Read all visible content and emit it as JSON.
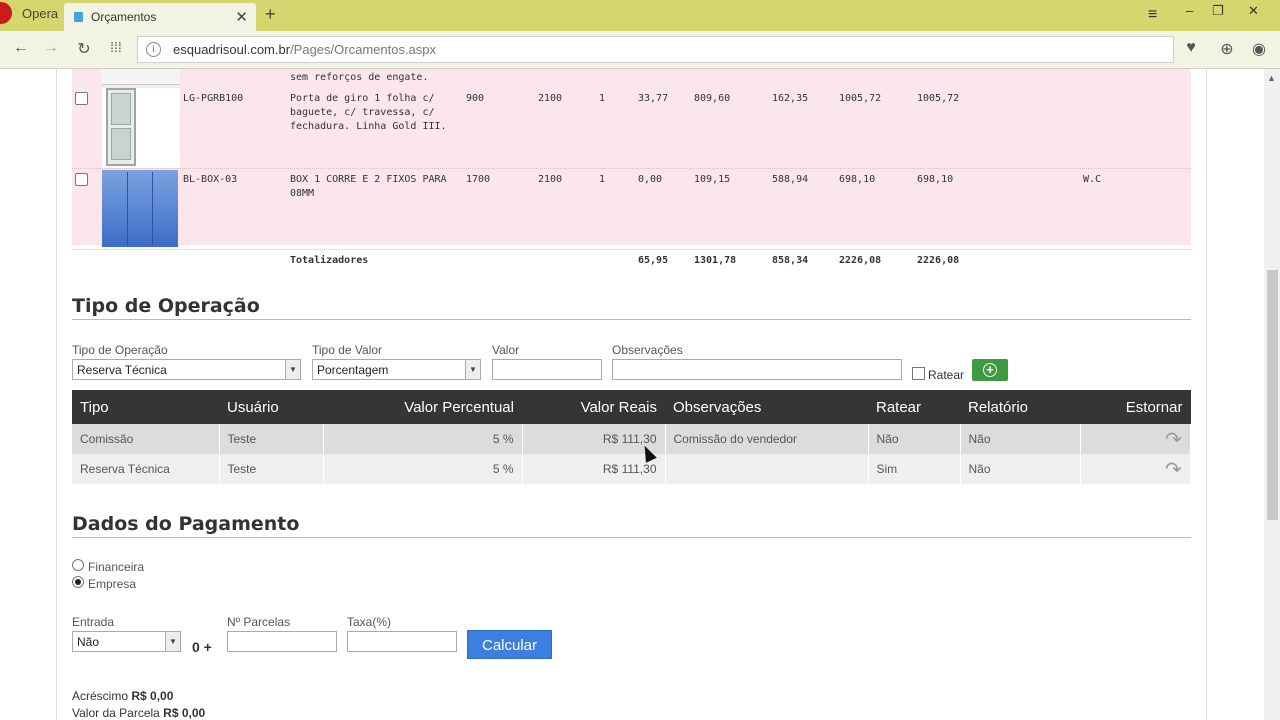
{
  "browser": {
    "app_name": "Opera",
    "tab_title": "Orçamentos",
    "url_host": "esquadrisoul.com.br",
    "url_path": "/Pages/Orcamentos.aspx"
  },
  "items": {
    "partial_desc": "sem reforços de engate.",
    "rows": [
      {
        "code": "LG-PGRB100",
        "desc": "Porta de giro 1 folha c/ baguete, c/ travessa, c/ fechadura. Linha Gold III.",
        "width": "900",
        "height": "2100",
        "qty": "1",
        "c1": "33,77",
        "c2": "809,60",
        "c3": "162,35",
        "c4": "1005,72",
        "c5": "1005,72",
        "note": ""
      },
      {
        "code": "BL-BOX-03",
        "desc": "BOX 1 CORRE E 2 FIXOS PARA 08MM",
        "width": "1700",
        "height": "2100",
        "qty": "1",
        "c1": "0,00",
        "c2": "109,15",
        "c3": "588,94",
        "c4": "698,10",
        "c5": "698,10",
        "note": "W.C"
      }
    ],
    "totals": {
      "label": "Totalizadores",
      "c1": "65,95",
      "c2": "1301,78",
      "c3": "858,34",
      "c4": "2226,08",
      "c5": "2226,08"
    }
  },
  "operacao": {
    "title": "Tipo de Operação",
    "label_tipo": "Tipo de Operação",
    "tipo_value": "Reserva Técnica",
    "label_valor_tipo": "Tipo de Valor",
    "valor_tipo_value": "Porcentagem",
    "label_valor": "Valor",
    "label_obs": "Observações",
    "ratear_label": "Ratear",
    "columns": [
      "Tipo",
      "Usuário",
      "Valor Percentual",
      "Valor Reais",
      "Observações",
      "Ratear",
      "Relatório",
      "Estornar"
    ],
    "rows": [
      {
        "tipo": "Comissão",
        "usuario": "Teste",
        "percentual": "5 %",
        "reais": "R$ 111,30",
        "obs": "Comissão do vendedor",
        "ratear": "Não",
        "relatorio": "Não"
      },
      {
        "tipo": "Reserva Técnica",
        "usuario": "Teste",
        "percentual": "5 %",
        "reais": "R$ 111,30",
        "obs": "",
        "ratear": "Sim",
        "relatorio": "Não"
      }
    ]
  },
  "pagamento": {
    "title": "Dados do Pagamento",
    "opt_financeira": "Financeira",
    "opt_empresa": "Empresa",
    "label_entrada": "Entrada",
    "entrada_value": "Não",
    "zero_plus": "0 +",
    "label_parcelas": "Nº Parcelas",
    "label_taxa": "Taxa(%)",
    "calc_label": "Calcular",
    "acrescimo_label": "Acréscimo",
    "acrescimo_value": "R$ 0,00",
    "parcela_label": "Valor da Parcela",
    "parcela_value": "R$ 0,00"
  }
}
